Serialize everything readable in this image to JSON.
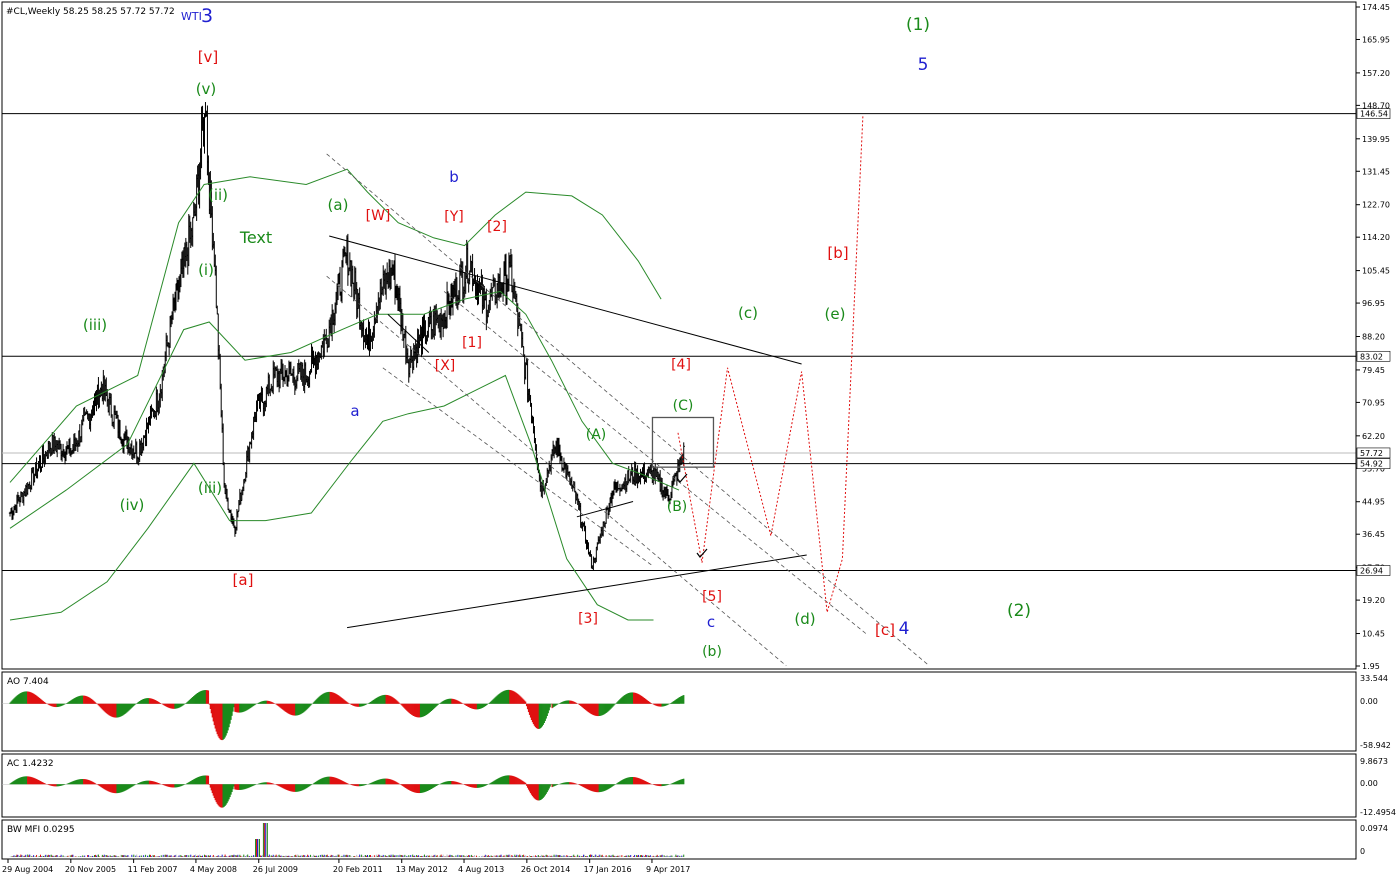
{
  "header": {
    "symbol_line": "#CL,Weekly  58.25 58.25 57.72 57.72",
    "instrument_badge": "WTI",
    "wave_digit": "3"
  },
  "chart_data": [
    {
      "type": "candlestick",
      "panel": "price",
      "ylim": [
        1.95,
        174.45
      ],
      "y_tick_labels": [
        "174.45",
        "165.95",
        "157.20",
        "148.70",
        "139.95",
        "131.45",
        "122.70",
        "114.20",
        "105.45",
        "96.95",
        "88.20",
        "79.45",
        "70.95",
        "62.20",
        "53.70",
        "44.95",
        "36.45",
        "27.70",
        "19.20",
        "10.45",
        "1.95"
      ],
      "x_tick_labels": [
        "29 Aug 2004",
        "20 Nov 2005",
        "11 Feb 2007",
        "4 May 2008",
        "26 Jul 2009",
        "20 Feb 2011",
        "13 May 2012",
        "4 Aug 2013",
        "26 Oct 2014",
        "17 Jan 2016",
        "9 Apr 2017"
      ],
      "price_tags": [
        {
          "value": "146.54",
          "color": "#ffffff",
          "text_color": "#000000"
        },
        {
          "value": "83.02",
          "color": "#ffffff",
          "text_color": "#000000"
        },
        {
          "value": "57.72",
          "color": "#ffffff",
          "text_color": "#000000"
        },
        {
          "value": "54.92",
          "color": "#ffffff",
          "text_color": "#000000"
        },
        {
          "value": "26.94",
          "color": "#ffffff",
          "text_color": "#000000"
        }
      ],
      "horizontal_lines": [
        146.54,
        83.02,
        54.92,
        26.94
      ],
      "approx_weekly_closes_by_year": {
        "2004.7": 42,
        "2005.0": 48,
        "2005.5": 60,
        "2005.9": 58,
        "2006.5": 75,
        "2006.9": 62,
        "2007.2": 58,
        "2007.6": 72,
        "2007.9": 95,
        "2008.3": 118,
        "2008.5": 145,
        "2008.7": 110,
        "2008.9": 48,
        "2009.1": 38,
        "2009.5": 68,
        "2009.9": 78,
        "2010.5": 78,
        "2010.9": 88,
        "2011.3": 110,
        "2011.7": 86,
        "2011.9": 98,
        "2012.2": 106,
        "2012.5": 82,
        "2012.9": 90,
        "2013.2": 94,
        "2013.7": 108,
        "2014.0": 96,
        "2014.5": 105,
        "2014.9": 70,
        "2015.1": 48,
        "2015.4": 60,
        "2015.8": 45,
        "2016.1": 28,
        "2016.5": 48,
        "2016.9": 52,
        "2017.3": 52,
        "2017.6": 46,
        "2017.9": 58
      },
      "wave_labels": [
        {
          "text": "(1)",
          "color": "#1a8a1a"
        },
        {
          "text": "5",
          "color": "#1f1fd0"
        },
        {
          "text": "[v]",
          "color": "#e01010"
        },
        {
          "text": "(v)",
          "color": "#1a8a1a"
        },
        {
          "text": "(ii)",
          "color": "#1a8a1a"
        },
        {
          "text": "(i)",
          "color": "#1a8a1a"
        },
        {
          "text": "Text",
          "color": "#1a8a1a"
        },
        {
          "text": "(iii)",
          "color": "#1a8a1a"
        },
        {
          "text": "(iv)",
          "color": "#1a8a1a"
        },
        {
          "text": "(iii)",
          "color": "#1a8a1a"
        },
        {
          "text": "[a]",
          "color": "#e01010"
        },
        {
          "text": "(a)",
          "color": "#1a8a1a"
        },
        {
          "text": "[W]",
          "color": "#e01010"
        },
        {
          "text": "b",
          "color": "#1f1fd0"
        },
        {
          "text": "[Y]",
          "color": "#e01010"
        },
        {
          "text": "[2]",
          "color": "#e01010"
        },
        {
          "text": "[1]",
          "color": "#e01010"
        },
        {
          "text": "[X]",
          "color": "#e01010"
        },
        {
          "text": "a",
          "color": "#1f1fd0"
        },
        {
          "text": "[b]",
          "color": "#e01010"
        },
        {
          "text": "(c)",
          "color": "#1a8a1a"
        },
        {
          "text": "(e)",
          "color": "#1a8a1a"
        },
        {
          "text": "[4]",
          "color": "#e01010"
        },
        {
          "text": "(C)",
          "color": "#1a8a1a"
        },
        {
          "text": "(A)",
          "color": "#1a8a1a"
        },
        {
          "text": "(B)",
          "color": "#1a8a1a"
        },
        {
          "text": "[5]",
          "color": "#e01010"
        },
        {
          "text": "[3]",
          "color": "#e01010"
        },
        {
          "text": "c",
          "color": "#1f1fd0"
        },
        {
          "text": "(b)",
          "color": "#1a8a1a"
        },
        {
          "text": "(d)",
          "color": "#1a8a1a"
        },
        {
          "text": "[c]",
          "color": "#e01010"
        },
        {
          "text": "4",
          "color": "#1f1fd0"
        },
        {
          "text": "(2)",
          "color": "#1a8a1a"
        }
      ]
    },
    {
      "type": "bar",
      "panel": "ao",
      "name": "AO 7.404",
      "y_tick_labels": [
        "33.544",
        "0.00",
        "-58.942"
      ],
      "ylim": [
        -58.942,
        33.544
      ]
    },
    {
      "type": "bar",
      "panel": "ac",
      "name": "AC 1.4232",
      "y_tick_labels": [
        "9.8673",
        "0.00",
        "-12.4954"
      ],
      "ylim": [
        -12.4954,
        9.8673
      ]
    },
    {
      "type": "bar",
      "panel": "bwmfi",
      "name": "BW MFI 0.0295",
      "y_tick_labels": [
        "0.0974",
        "0"
      ],
      "ylim": [
        0,
        0.0974
      ]
    }
  ],
  "colors": {
    "up": "#1a8a1a",
    "down": "#e01010",
    "candle": "#000000",
    "channel": "#555555",
    "bands": "#2a8a2a",
    "projection": "#e01010"
  }
}
